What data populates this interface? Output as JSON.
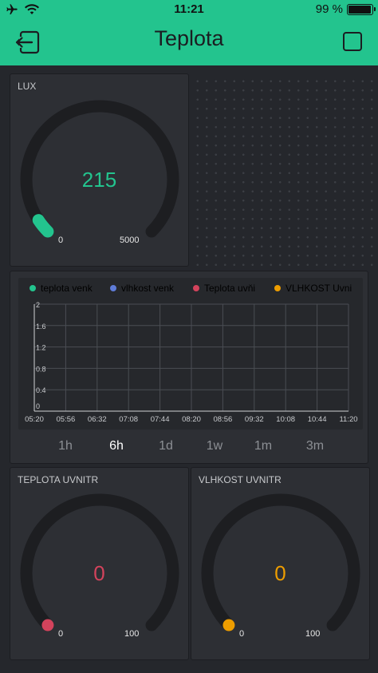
{
  "status_bar": {
    "time": "11:21",
    "battery_pct": "99 %"
  },
  "header": {
    "title": "Teplota"
  },
  "colors": {
    "accent": "#23c48e",
    "lux": "#23c48e",
    "teplota_venk": "#23c48e",
    "vlhkost_venk": "#5f7cd8",
    "teplota_uvni": "#d3435c",
    "vlhkost_uvni": "#ed9d00",
    "gauge_track": "#1d1e21"
  },
  "lux_gauge": {
    "label": "LUX",
    "value": "215",
    "min": "0",
    "max": "5000",
    "level": 0.043
  },
  "chart": {
    "legend": [
      {
        "name": "teplota venk",
        "color": "#23c48e"
      },
      {
        "name": "vlhkost venk",
        "color": "#5f7cd8"
      },
      {
        "name": "Teplota uvňi",
        "color": "#d3435c"
      },
      {
        "name": "VLHKOST Uvni",
        "color": "#ed9d00"
      }
    ],
    "y_ticks": [
      "2",
      "1.6",
      "1.2",
      "0.8",
      "0.4",
      "0"
    ],
    "x_ticks": [
      "05:20",
      "05:56",
      "06:32",
      "07:08",
      "07:44",
      "08:20",
      "08:56",
      "09:32",
      "10:08",
      "10:44",
      "11:20"
    ],
    "ranges": [
      "1h",
      "6h",
      "1d",
      "1w",
      "1m",
      "3m"
    ],
    "active_range": "6h"
  },
  "chart_data": {
    "type": "line",
    "title": "",
    "xlabel": "",
    "ylabel": "",
    "ylim": [
      0,
      2
    ],
    "x": [
      "05:20",
      "05:56",
      "06:32",
      "07:08",
      "07:44",
      "08:20",
      "08:56",
      "09:32",
      "10:08",
      "10:44",
      "11:20"
    ],
    "series": [
      {
        "name": "teplota venk",
        "values": []
      },
      {
        "name": "vlhkost venk",
        "values": []
      },
      {
        "name": "Teplota uvňi",
        "values": []
      },
      {
        "name": "VLHKOST Uvni",
        "values": []
      }
    ],
    "grid": true,
    "legend": "top"
  },
  "teplota_gauge": {
    "label": "TEPLOTA UVNITR",
    "value": "0",
    "min": "0",
    "max": "100",
    "level": 0
  },
  "vlhkost_gauge": {
    "label": "VLHKOST UVNITR",
    "value": "0",
    "min": "0",
    "max": "100",
    "level": 0
  }
}
